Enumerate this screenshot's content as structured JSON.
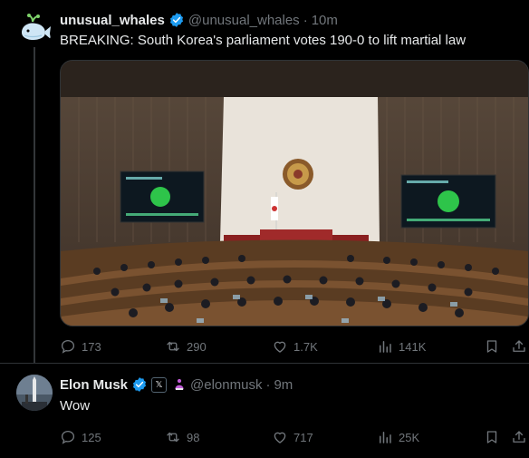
{
  "tweet": {
    "author_name": "unusual_whales",
    "handle": "@unusual_whales",
    "separator": "·",
    "time": "10m",
    "text": "BREAKING: South Korea's parliament votes 190-0 to lift martial law",
    "stats": {
      "replies": "173",
      "reposts": "290",
      "likes": "1.7K",
      "views": "141K"
    }
  },
  "reply": {
    "author_name": "Elon Musk",
    "x_badge": "𝕏",
    "handle": "@elonmusk",
    "separator": "·",
    "time": "9m",
    "text": "Wow",
    "stats": {
      "replies": "125",
      "reposts": "98",
      "likes": "717",
      "views": "25K"
    }
  },
  "colors": {
    "verified": "#1d9bf0",
    "muted": "#71767b",
    "text": "#e7e9ea",
    "affiliate": "#c05bd6"
  },
  "icons": [
    "whale-avatar",
    "verified-icon",
    "reply-icon",
    "repost-icon",
    "like-icon",
    "views-icon",
    "bookmark-icon",
    "share-icon",
    "affiliate-icon",
    "x-badge-icon"
  ]
}
